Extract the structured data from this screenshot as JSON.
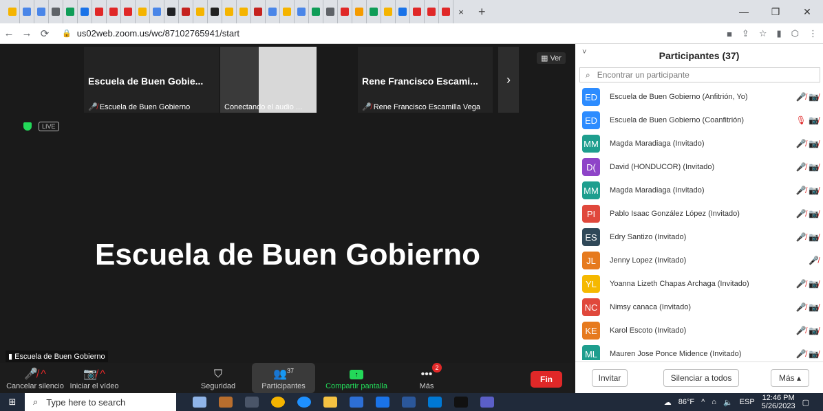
{
  "browser": {
    "tab_close": "×",
    "new_tab": "+",
    "url": "us02web.zoom.us/wc/87102765941/start",
    "win_min": "—",
    "win_restore": "❐",
    "win_close": "✕",
    "tab_colors": [
      "#f5b400",
      "#4a86e8",
      "#4a86e8",
      "#5f6368",
      "#0f9d58",
      "#1a73e8",
      "#e02828",
      "#e02828",
      "#e02828",
      "#f5b400",
      "#4a86e8",
      "#202124",
      "#c5221f",
      "#f5b400",
      "#222222",
      "#f5b400",
      "#f5b400",
      "#c5221f",
      "#4a86e8",
      "#f5b400",
      "#4a86e8",
      "#0f9d58",
      "#5f6368",
      "#e02828",
      "#f59b00",
      "#0f9d58",
      "#f5b400",
      "#1a73e8",
      "#e02828",
      "#e02828",
      "#e02828"
    ]
  },
  "meeting": {
    "view_label": "Ver",
    "thumbnails": [
      {
        "title": "Escuela de Buen Gobie...",
        "sub": "Escuela de Buen Gobierno"
      },
      {
        "title": "",
        "sub": "Conectando el audio ..."
      },
      {
        "title": "Rene Francisco Escami...",
        "sub": "Rene Francisco Escamilla Vega"
      }
    ],
    "live_label": "LIVE",
    "speaker_name": "Escuela de Buen Gobierno",
    "bottom_label": "Escuela de Buen Gobierno"
  },
  "toolbar": {
    "unmute_label": "Cancelar silencio",
    "video_label": "Iniciar el vídeo",
    "security_label": "Seguridad",
    "participants_label": "Participantes",
    "participants_count": "37",
    "share_label": "Compartir pantalla",
    "more_label": "Más",
    "more_badge": "2",
    "end_label": "Fin"
  },
  "panel": {
    "title": "Participantes (37)",
    "search_placeholder": "Encontrar un participante",
    "participants": [
      {
        "initials": "ED",
        "color": "#2d8cff",
        "name": "Escuela de Buen Gobierno (Anfitrión, Yo)",
        "icons": "🎤̸ 📷̸"
      },
      {
        "initials": "ED",
        "color": "#2d8cff",
        "name": "Escuela de Buen Gobierno (Coanfitrión)",
        "icons": "🎙 📷̸"
      },
      {
        "initials": "MM",
        "color": "#1e9e8e",
        "name": "Magda Maradiaga (Invitado)",
        "icons": "🎤̸ 📷̸"
      },
      {
        "initials": "D(",
        "color": "#8e44c8",
        "name": "David (HONDUCOR) (Invitado)",
        "icons": "🎤̸ 📷̸"
      },
      {
        "initials": "MM",
        "color": "#1e9e8e",
        "name": "Magda Maradiaga (Invitado)",
        "icons": "🎤̸ 📷̸"
      },
      {
        "initials": "PI",
        "color": "#e0483c",
        "name": "Pablo Isaac González López (Invitado)",
        "icons": "🎤̸ 📷̸"
      },
      {
        "initials": "ES",
        "color": "#2f4858",
        "name": "Edry Santizo (Invitado)",
        "icons": "🎤̸ 📷̸"
      },
      {
        "initials": "JL",
        "color": "#e67a1e",
        "name": "Jenny Lopez (Invitado)",
        "icons": "🎤̸"
      },
      {
        "initials": "YL",
        "color": "#f5b800",
        "name": "Yoanna Lizeth Chapas Archaga (Invitado)",
        "icons": "🎤̸ 📷̸"
      },
      {
        "initials": "NC",
        "color": "#e0483c",
        "name": "Nimsy canaca (Invitado)",
        "icons": "🎤̸ 📷̸"
      },
      {
        "initials": "KE",
        "color": "#e67a1e",
        "name": "Karol Escoto (Invitado)",
        "icons": "🎤̸ 📷̸"
      },
      {
        "initials": "ML",
        "color": "#1e9e8e",
        "name": "Mauren Jose Ponce Midence (Invitado)",
        "icons": "🎤̸ 📷̸"
      }
    ],
    "invite_label": "Invitar",
    "mute_all_label": "Silenciar a todos",
    "more_label": "Más ▴"
  },
  "taskbar": {
    "search_placeholder": "Type here to search",
    "weather": "86°F",
    "language": "ESP",
    "time": "12:46 PM",
    "date": "5/26/2023"
  }
}
